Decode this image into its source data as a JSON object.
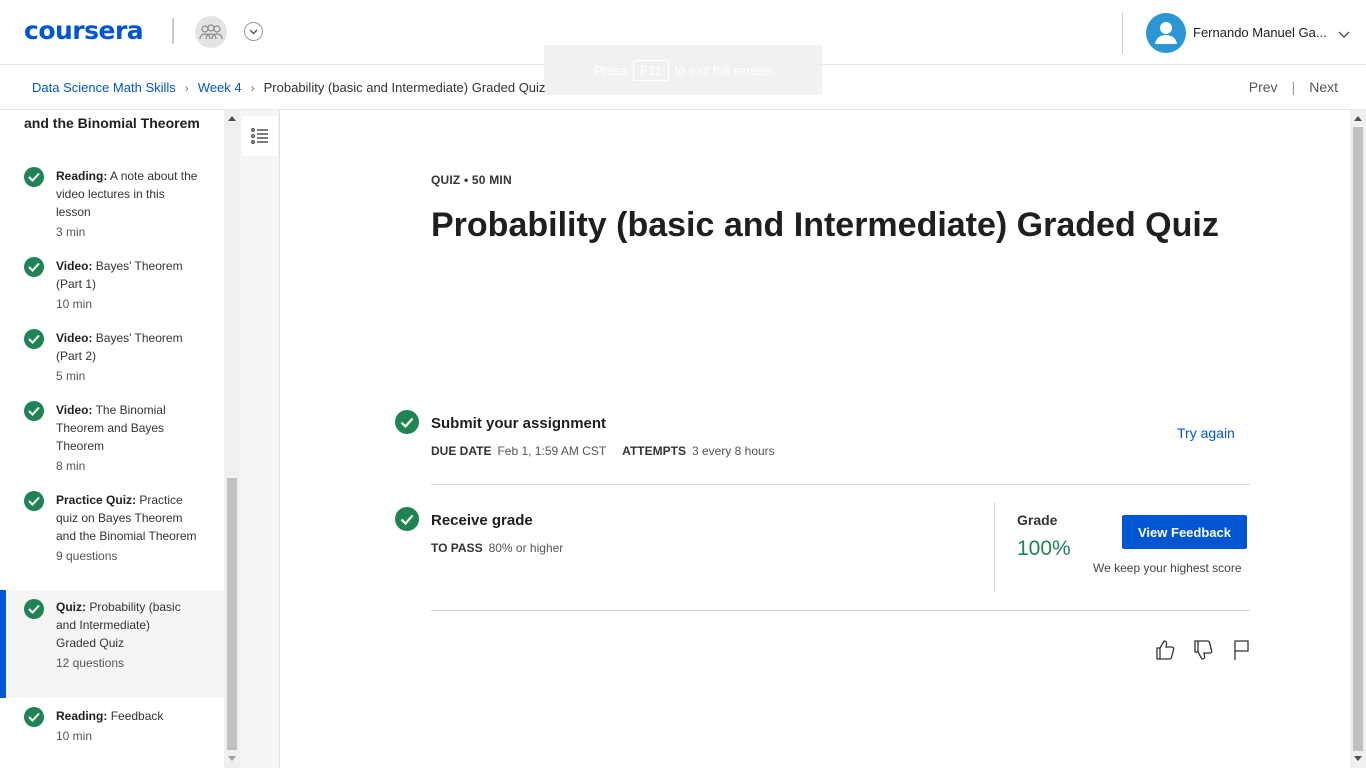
{
  "header": {
    "logo": "coursera",
    "user_name": "Fernando Manuel Ga...",
    "fullscreen_hint": {
      "prefix": "Press",
      "key": "F11",
      "suffix": "to exit full screen"
    }
  },
  "breadcrumb": {
    "items": [
      "Data Science Math Skills",
      "Week 4",
      "Probability (basic and Intermediate) Graded Quiz"
    ],
    "prev": "Prev",
    "next": "Next"
  },
  "sidebar": {
    "lesson_title": "and the Binomial Theorem",
    "items": [
      {
        "type": "Reading:",
        "title": "A note about the video lectures in this lesson",
        "meta": "3 min",
        "completed": true
      },
      {
        "type": "Video:",
        "title": "Bayes' Theorem (Part 1)",
        "meta": "10 min",
        "completed": true
      },
      {
        "type": "Video:",
        "title": "Bayes' Theorem (Part 2)",
        "meta": "5 min",
        "completed": true
      },
      {
        "type": "Video:",
        "title": "The Binomial Theorem and Bayes Theorem",
        "meta": "8 min",
        "completed": true
      },
      {
        "type": "Practice Quiz:",
        "title": "Practice quiz on Bayes Theorem and the Binomial Theorem",
        "meta": "9 questions",
        "completed": true
      },
      {
        "type": "Quiz:",
        "title": "Probability (basic and Intermediate) Graded Quiz",
        "meta": "12 questions",
        "completed": true,
        "active": true
      },
      {
        "type": "Reading:",
        "title": "Feedback",
        "meta": "10 min",
        "completed": true
      }
    ]
  },
  "main": {
    "eyebrow": "QUIZ • 50 MIN",
    "title": "Probability (basic and Intermediate) Graded Quiz",
    "submit": {
      "title": "Submit your assignment",
      "due_label": "DUE DATE",
      "due_value": "Feb 1, 1:59 AM CST",
      "attempts_label": "ATTEMPTS",
      "attempts_value": "3 every 8 hours",
      "try_again": "Try again"
    },
    "receive": {
      "title": "Receive grade",
      "pass_label": "TO PASS",
      "pass_value": "80% or higher",
      "grade_label": "Grade",
      "grade_value": "100%",
      "view_feedback": "View Feedback",
      "keep_score": "We keep your highest score"
    }
  },
  "colors": {
    "brand": "#0056d2",
    "success": "#1f8354"
  }
}
